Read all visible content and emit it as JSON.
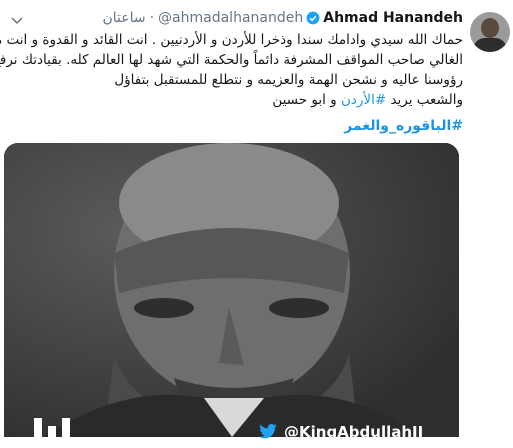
{
  "author": {
    "name": "Ahmad Hanandeh",
    "handle": "@ahmadalhanandeh",
    "separator": "·",
    "time": "ساعتان"
  },
  "tweet": {
    "lines": [
      "حماك الله سيدي وادامك سندا وذخرا للأردن و الأردنيين . انت القائد و القدوة و انت ملكنا",
      "الغالي صاحب المواقف المشرفة دائماً والحكمة التي شهد لها العالم كله. بقيادتك نرفع",
      "رؤوسنا عاليه و نشحن الهمة والعزيمه و نتطلع للمستقبل بتفاؤل"
    ],
    "last_line_prefix": "والشعب يريد",
    "last_line_hashtag": "#الأردن",
    "last_line_suffix": "و ابو حسين",
    "hashtag": "#الباقوره_والغمر"
  },
  "media": {
    "watermark": "@KingAbdullahII"
  },
  "colors": {
    "link": "#1b95e0",
    "verified": "#1da1f2",
    "muted": "#657786"
  },
  "icons": {
    "verified": "verified-badge-icon",
    "caret": "chevron-down-icon",
    "watermark": "twitter-bird-icon"
  }
}
